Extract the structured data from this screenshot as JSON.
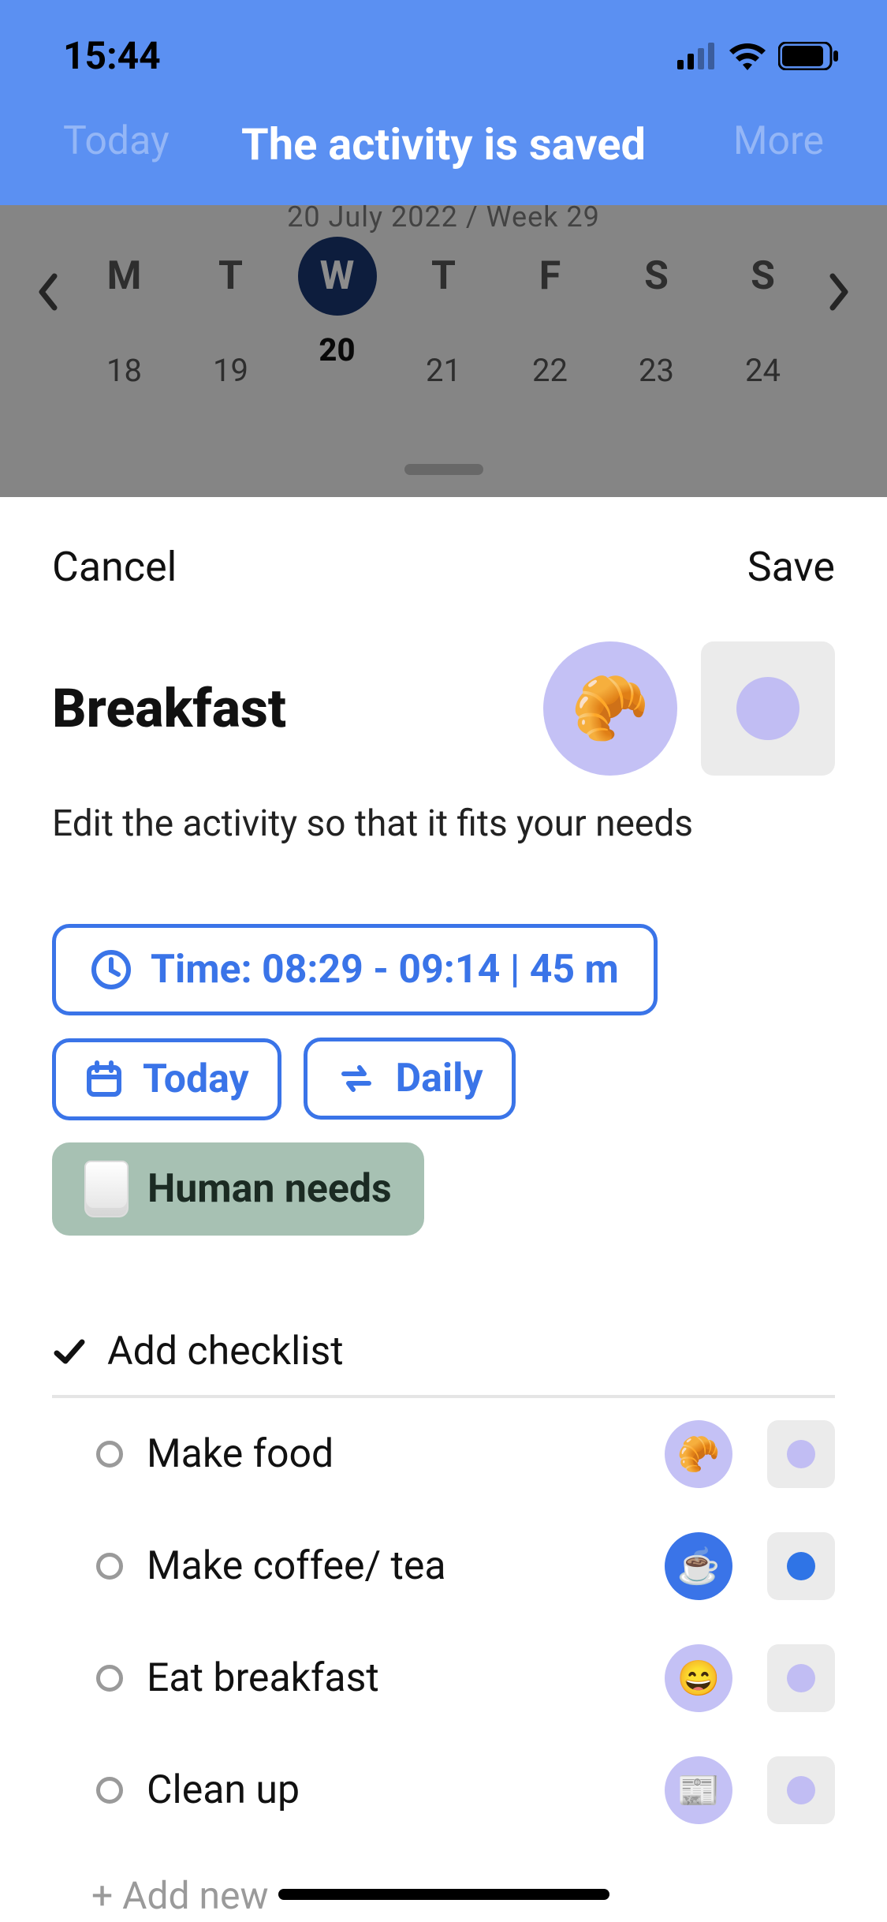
{
  "statusbar": {
    "time": "15:44"
  },
  "banner": {
    "left": "Today",
    "title": "The activity is saved",
    "right": "More"
  },
  "calendar": {
    "dateline": "20 July 2022 / Week 29",
    "days": [
      {
        "dow": "M",
        "num": "18"
      },
      {
        "dow": "T",
        "num": "19"
      },
      {
        "dow": "W",
        "num": "20",
        "selected": true
      },
      {
        "dow": "T",
        "num": "21"
      },
      {
        "dow": "F",
        "num": "22"
      },
      {
        "dow": "S",
        "num": "23"
      },
      {
        "dow": "S",
        "num": "24"
      }
    ]
  },
  "sheet": {
    "cancel": "Cancel",
    "save": "Save",
    "title": "Breakfast",
    "subtitle": "Edit the activity so that it fits your needs",
    "time_label": "Time: 08:29 - 09:14  |  45 m",
    "date_label": "Today",
    "repeat_label": "Daily",
    "category_label": "Human needs",
    "icon_emoji": "🥐",
    "checklist_header": "Add checklist",
    "checklist": [
      {
        "label": "Make food",
        "emoji": "🥐",
        "color": "#c1bdf3",
        "iconbg": "#c4c1f5"
      },
      {
        "label": "Make coffee/ tea",
        "emoji": "☕",
        "color": "#2f74e6",
        "iconbg": "#3a74e8"
      },
      {
        "label": "Eat breakfast",
        "emoji": "😄",
        "color": "#c1bdf3",
        "iconbg": "#c4c1f5"
      },
      {
        "label": "Clean up",
        "emoji": "📰",
        "color": "#c1bdf3",
        "iconbg": "#c4c1f5"
      }
    ],
    "add_new": "+ Add new"
  }
}
